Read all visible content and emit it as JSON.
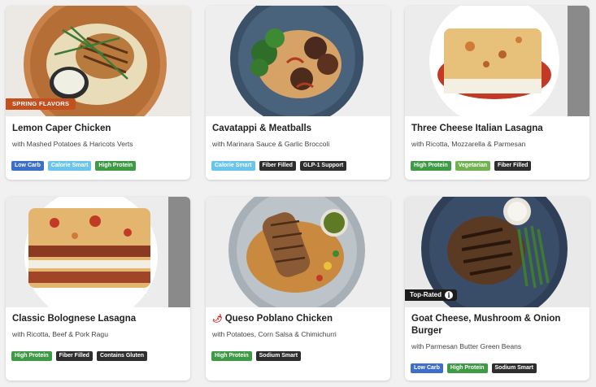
{
  "colors": {
    "low_carb": "#3e6fc8",
    "calorie_smart": "#6ac4ec",
    "high_protein": "#3f9a45",
    "vegetarian": "#6fb24f",
    "dark_badge": "#2e2e2e",
    "promo": "#c4501f"
  },
  "cards": [
    {
      "title": "Lemon Caper Chicken",
      "subtitle": "with Mashed Potatoes & Haricots Verts",
      "promo": "SPRING FLAVORS",
      "badges": [
        "Low Carb",
        "Calorie Smart",
        "High Protein"
      ]
    },
    {
      "title": "Cavatappi & Meatballs",
      "subtitle": "with Marinara Sauce & Garlic Broccoli",
      "badges": [
        "Calorie Smart",
        "Fiber Filled",
        "GLP-1 Support"
      ]
    },
    {
      "title": "Three Cheese Italian Lasagna",
      "subtitle": "with Ricotta, Mozzarella & Parmesan",
      "badges": [
        "High Protein",
        "Vegetarian",
        "Fiber Filled"
      ]
    },
    {
      "title": "Classic Bolognese Lasagna",
      "subtitle": "with Ricotta, Beef & Pork Ragu",
      "badges": [
        "High Protein",
        "Fiber Filled",
        "Contains Gluten"
      ]
    },
    {
      "title": "Queso Poblano Chicken",
      "subtitle": "with Potatoes, Corn Salsa & Chimichurri",
      "icon": "chili-pepper-icon",
      "badges": [
        "High Protein",
        "Sodium Smart"
      ]
    },
    {
      "title": "Goat Cheese, Mushroom & Onion Burger",
      "subtitle": "with Parmesan Butter Green Beans",
      "label": "Top-Rated",
      "badges": [
        "Low Carb",
        "High Protein",
        "Sodium Smart"
      ]
    }
  ]
}
